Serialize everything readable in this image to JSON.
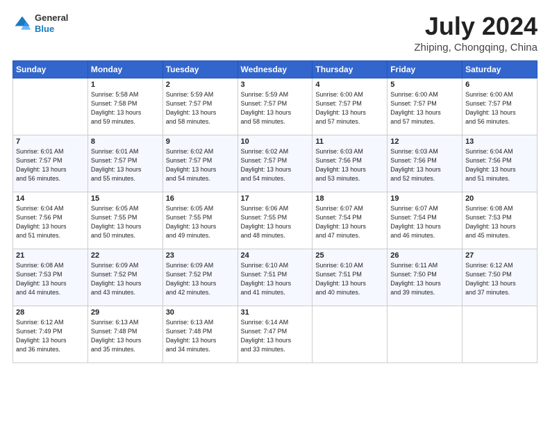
{
  "header": {
    "logo_general": "General",
    "logo_blue": "Blue",
    "month_title": "July 2024",
    "location": "Zhiping, Chongqing, China"
  },
  "weekdays": [
    "Sunday",
    "Monday",
    "Tuesday",
    "Wednesday",
    "Thursday",
    "Friday",
    "Saturday"
  ],
  "weeks": [
    [
      {
        "num": "",
        "info": ""
      },
      {
        "num": "1",
        "info": "Sunrise: 5:58 AM\nSunset: 7:58 PM\nDaylight: 13 hours\nand 59 minutes."
      },
      {
        "num": "2",
        "info": "Sunrise: 5:59 AM\nSunset: 7:57 PM\nDaylight: 13 hours\nand 58 minutes."
      },
      {
        "num": "3",
        "info": "Sunrise: 5:59 AM\nSunset: 7:57 PM\nDaylight: 13 hours\nand 58 minutes."
      },
      {
        "num": "4",
        "info": "Sunrise: 6:00 AM\nSunset: 7:57 PM\nDaylight: 13 hours\nand 57 minutes."
      },
      {
        "num": "5",
        "info": "Sunrise: 6:00 AM\nSunset: 7:57 PM\nDaylight: 13 hours\nand 57 minutes."
      },
      {
        "num": "6",
        "info": "Sunrise: 6:00 AM\nSunset: 7:57 PM\nDaylight: 13 hours\nand 56 minutes."
      }
    ],
    [
      {
        "num": "7",
        "info": "Sunrise: 6:01 AM\nSunset: 7:57 PM\nDaylight: 13 hours\nand 56 minutes."
      },
      {
        "num": "8",
        "info": "Sunrise: 6:01 AM\nSunset: 7:57 PM\nDaylight: 13 hours\nand 55 minutes."
      },
      {
        "num": "9",
        "info": "Sunrise: 6:02 AM\nSunset: 7:57 PM\nDaylight: 13 hours\nand 54 minutes."
      },
      {
        "num": "10",
        "info": "Sunrise: 6:02 AM\nSunset: 7:57 PM\nDaylight: 13 hours\nand 54 minutes."
      },
      {
        "num": "11",
        "info": "Sunrise: 6:03 AM\nSunset: 7:56 PM\nDaylight: 13 hours\nand 53 minutes."
      },
      {
        "num": "12",
        "info": "Sunrise: 6:03 AM\nSunset: 7:56 PM\nDaylight: 13 hours\nand 52 minutes."
      },
      {
        "num": "13",
        "info": "Sunrise: 6:04 AM\nSunset: 7:56 PM\nDaylight: 13 hours\nand 51 minutes."
      }
    ],
    [
      {
        "num": "14",
        "info": "Sunrise: 6:04 AM\nSunset: 7:56 PM\nDaylight: 13 hours\nand 51 minutes."
      },
      {
        "num": "15",
        "info": "Sunrise: 6:05 AM\nSunset: 7:55 PM\nDaylight: 13 hours\nand 50 minutes."
      },
      {
        "num": "16",
        "info": "Sunrise: 6:05 AM\nSunset: 7:55 PM\nDaylight: 13 hours\nand 49 minutes."
      },
      {
        "num": "17",
        "info": "Sunrise: 6:06 AM\nSunset: 7:55 PM\nDaylight: 13 hours\nand 48 minutes."
      },
      {
        "num": "18",
        "info": "Sunrise: 6:07 AM\nSunset: 7:54 PM\nDaylight: 13 hours\nand 47 minutes."
      },
      {
        "num": "19",
        "info": "Sunrise: 6:07 AM\nSunset: 7:54 PM\nDaylight: 13 hours\nand 46 minutes."
      },
      {
        "num": "20",
        "info": "Sunrise: 6:08 AM\nSunset: 7:53 PM\nDaylight: 13 hours\nand 45 minutes."
      }
    ],
    [
      {
        "num": "21",
        "info": "Sunrise: 6:08 AM\nSunset: 7:53 PM\nDaylight: 13 hours\nand 44 minutes."
      },
      {
        "num": "22",
        "info": "Sunrise: 6:09 AM\nSunset: 7:52 PM\nDaylight: 13 hours\nand 43 minutes."
      },
      {
        "num": "23",
        "info": "Sunrise: 6:09 AM\nSunset: 7:52 PM\nDaylight: 13 hours\nand 42 minutes."
      },
      {
        "num": "24",
        "info": "Sunrise: 6:10 AM\nSunset: 7:51 PM\nDaylight: 13 hours\nand 41 minutes."
      },
      {
        "num": "25",
        "info": "Sunrise: 6:10 AM\nSunset: 7:51 PM\nDaylight: 13 hours\nand 40 minutes."
      },
      {
        "num": "26",
        "info": "Sunrise: 6:11 AM\nSunset: 7:50 PM\nDaylight: 13 hours\nand 39 minutes."
      },
      {
        "num": "27",
        "info": "Sunrise: 6:12 AM\nSunset: 7:50 PM\nDaylight: 13 hours\nand 37 minutes."
      }
    ],
    [
      {
        "num": "28",
        "info": "Sunrise: 6:12 AM\nSunset: 7:49 PM\nDaylight: 13 hours\nand 36 minutes."
      },
      {
        "num": "29",
        "info": "Sunrise: 6:13 AM\nSunset: 7:48 PM\nDaylight: 13 hours\nand 35 minutes."
      },
      {
        "num": "30",
        "info": "Sunrise: 6:13 AM\nSunset: 7:48 PM\nDaylight: 13 hours\nand 34 minutes."
      },
      {
        "num": "31",
        "info": "Sunrise: 6:14 AM\nSunset: 7:47 PM\nDaylight: 13 hours\nand 33 minutes."
      },
      {
        "num": "",
        "info": ""
      },
      {
        "num": "",
        "info": ""
      },
      {
        "num": "",
        "info": ""
      }
    ]
  ]
}
